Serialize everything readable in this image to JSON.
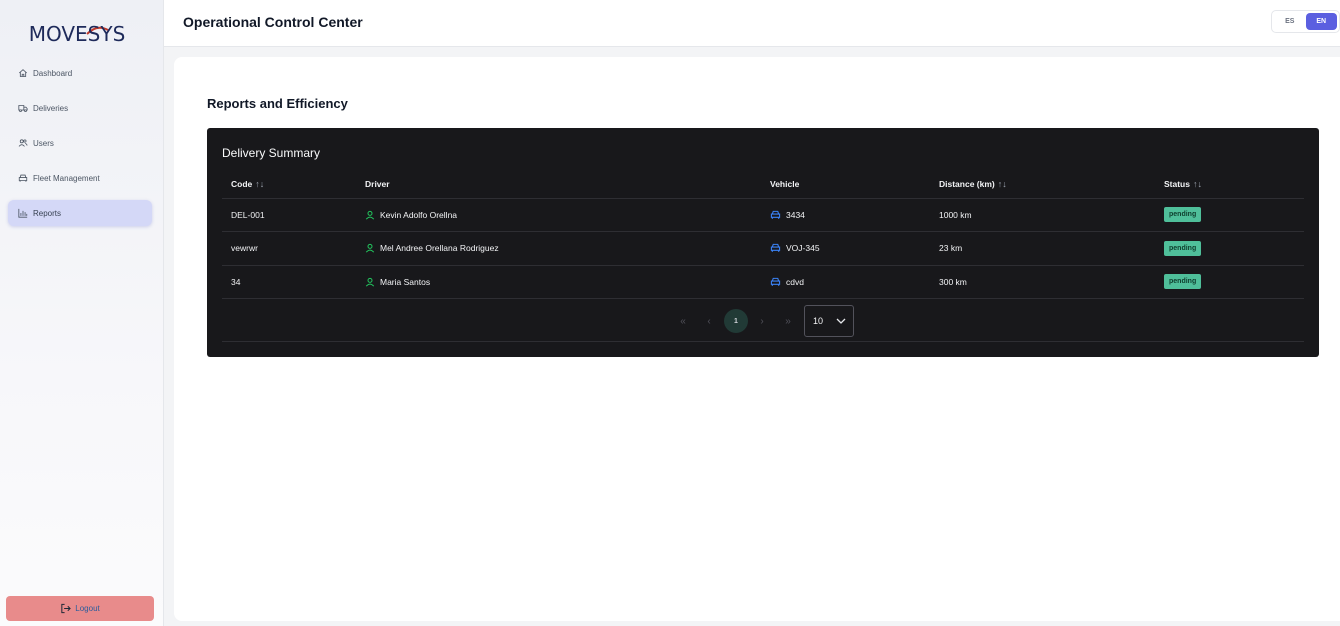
{
  "brand": {
    "logo_text": "MOVESYS",
    "accent": "#c0392b",
    "primary": "#1e2a5a"
  },
  "sidebar": {
    "items": [
      {
        "label": "Dashboard",
        "icon": "home-icon"
      },
      {
        "label": "Deliveries",
        "icon": "truck-icon"
      },
      {
        "label": "Users",
        "icon": "users-icon"
      },
      {
        "label": "Fleet Management",
        "icon": "car-icon"
      },
      {
        "label": "Reports",
        "icon": "bar-chart-icon",
        "active": true
      }
    ],
    "logout_label": "Logout"
  },
  "header": {
    "title": "Operational Control Center",
    "languages": [
      {
        "code": "ES"
      },
      {
        "code": "EN",
        "active": true
      }
    ]
  },
  "main": {
    "section_title": "Reports and Efficiency",
    "table": {
      "title": "Delivery Summary",
      "columns": [
        {
          "label": "Code",
          "sortable": true
        },
        {
          "label": "Driver",
          "sortable": false
        },
        {
          "label": "Vehicle",
          "sortable": false
        },
        {
          "label": "Distance (km)",
          "sortable": true
        },
        {
          "label": "Status",
          "sortable": true
        }
      ],
      "rows": [
        {
          "code": "DEL-001",
          "driver": "Kevin Adolfo Orellna",
          "vehicle": "3434",
          "distance": "1000 km",
          "status": "pending"
        },
        {
          "code": "vewrwr",
          "driver": "Mel Andree Orellana Rodriguez",
          "vehicle": "VOJ-345",
          "distance": "23 km",
          "status": "pending"
        },
        {
          "code": "34",
          "driver": "Maria Santos",
          "vehicle": "cdvd",
          "distance": "300 km",
          "status": "pending"
        }
      ],
      "pagination": {
        "current_page": "1",
        "page_size": "10",
        "first_icon": "«",
        "prev_icon": "‹",
        "next_icon": "›",
        "last_icon": "»"
      },
      "colors": {
        "status_pending": "#4fbf9a",
        "driver_icon": "#22c55e",
        "vehicle_icon": "#3b82f6",
        "background": "#18181b"
      }
    }
  }
}
